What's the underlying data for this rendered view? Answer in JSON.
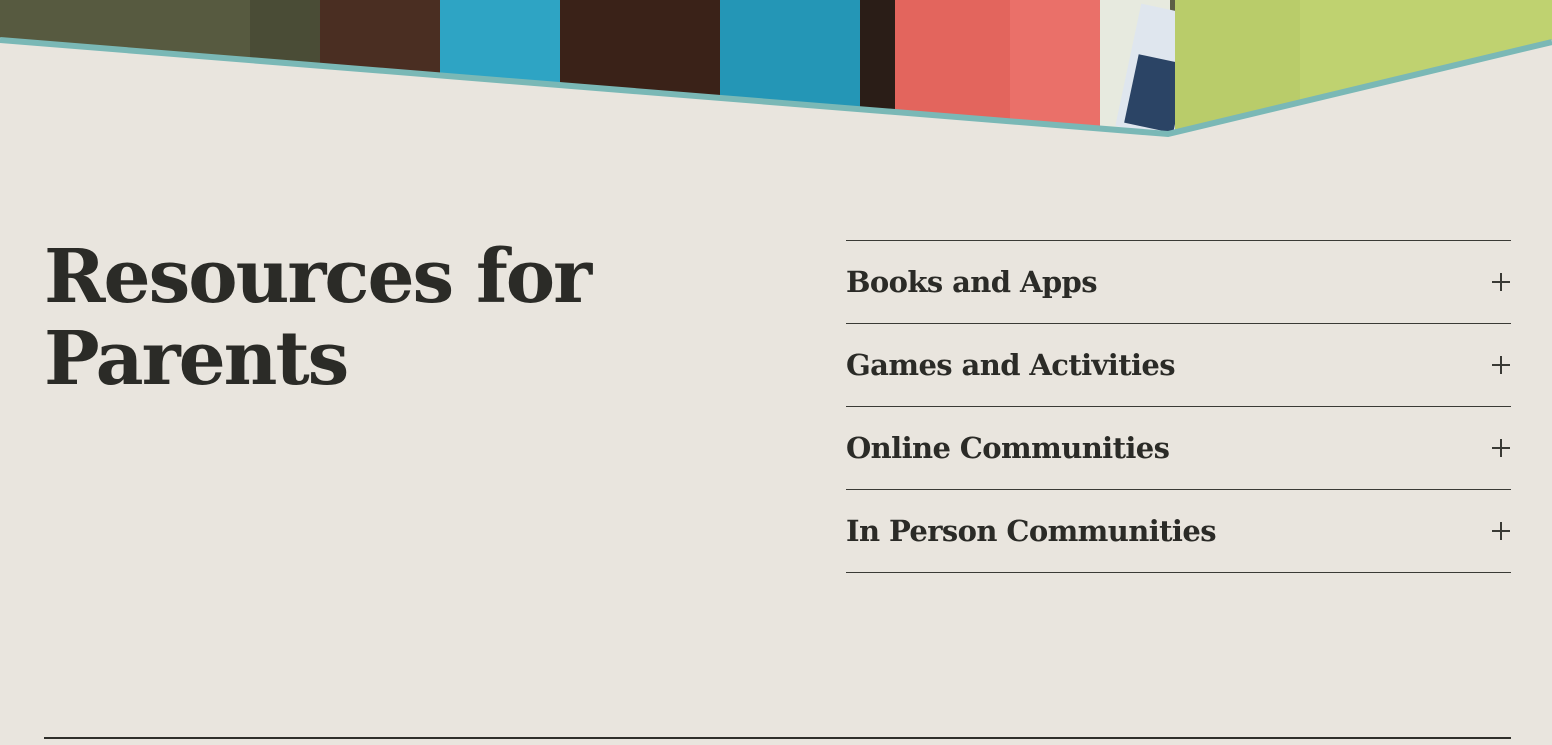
{
  "page": {
    "title_line1": "Resources for",
    "title_line2": "Parents"
  },
  "accordion": {
    "items": [
      {
        "label": "Books and Apps",
        "icon": "plus-icon"
      },
      {
        "label": "Games and Activities",
        "icon": "plus-icon"
      },
      {
        "label": "Online Communities",
        "icon": "plus-icon"
      },
      {
        "label": "In Person Communities",
        "icon": "plus-icon"
      }
    ]
  },
  "colors": {
    "background": "#e9e5de",
    "accent_teal": "#7ab8b6",
    "text": "#2b2b27"
  }
}
